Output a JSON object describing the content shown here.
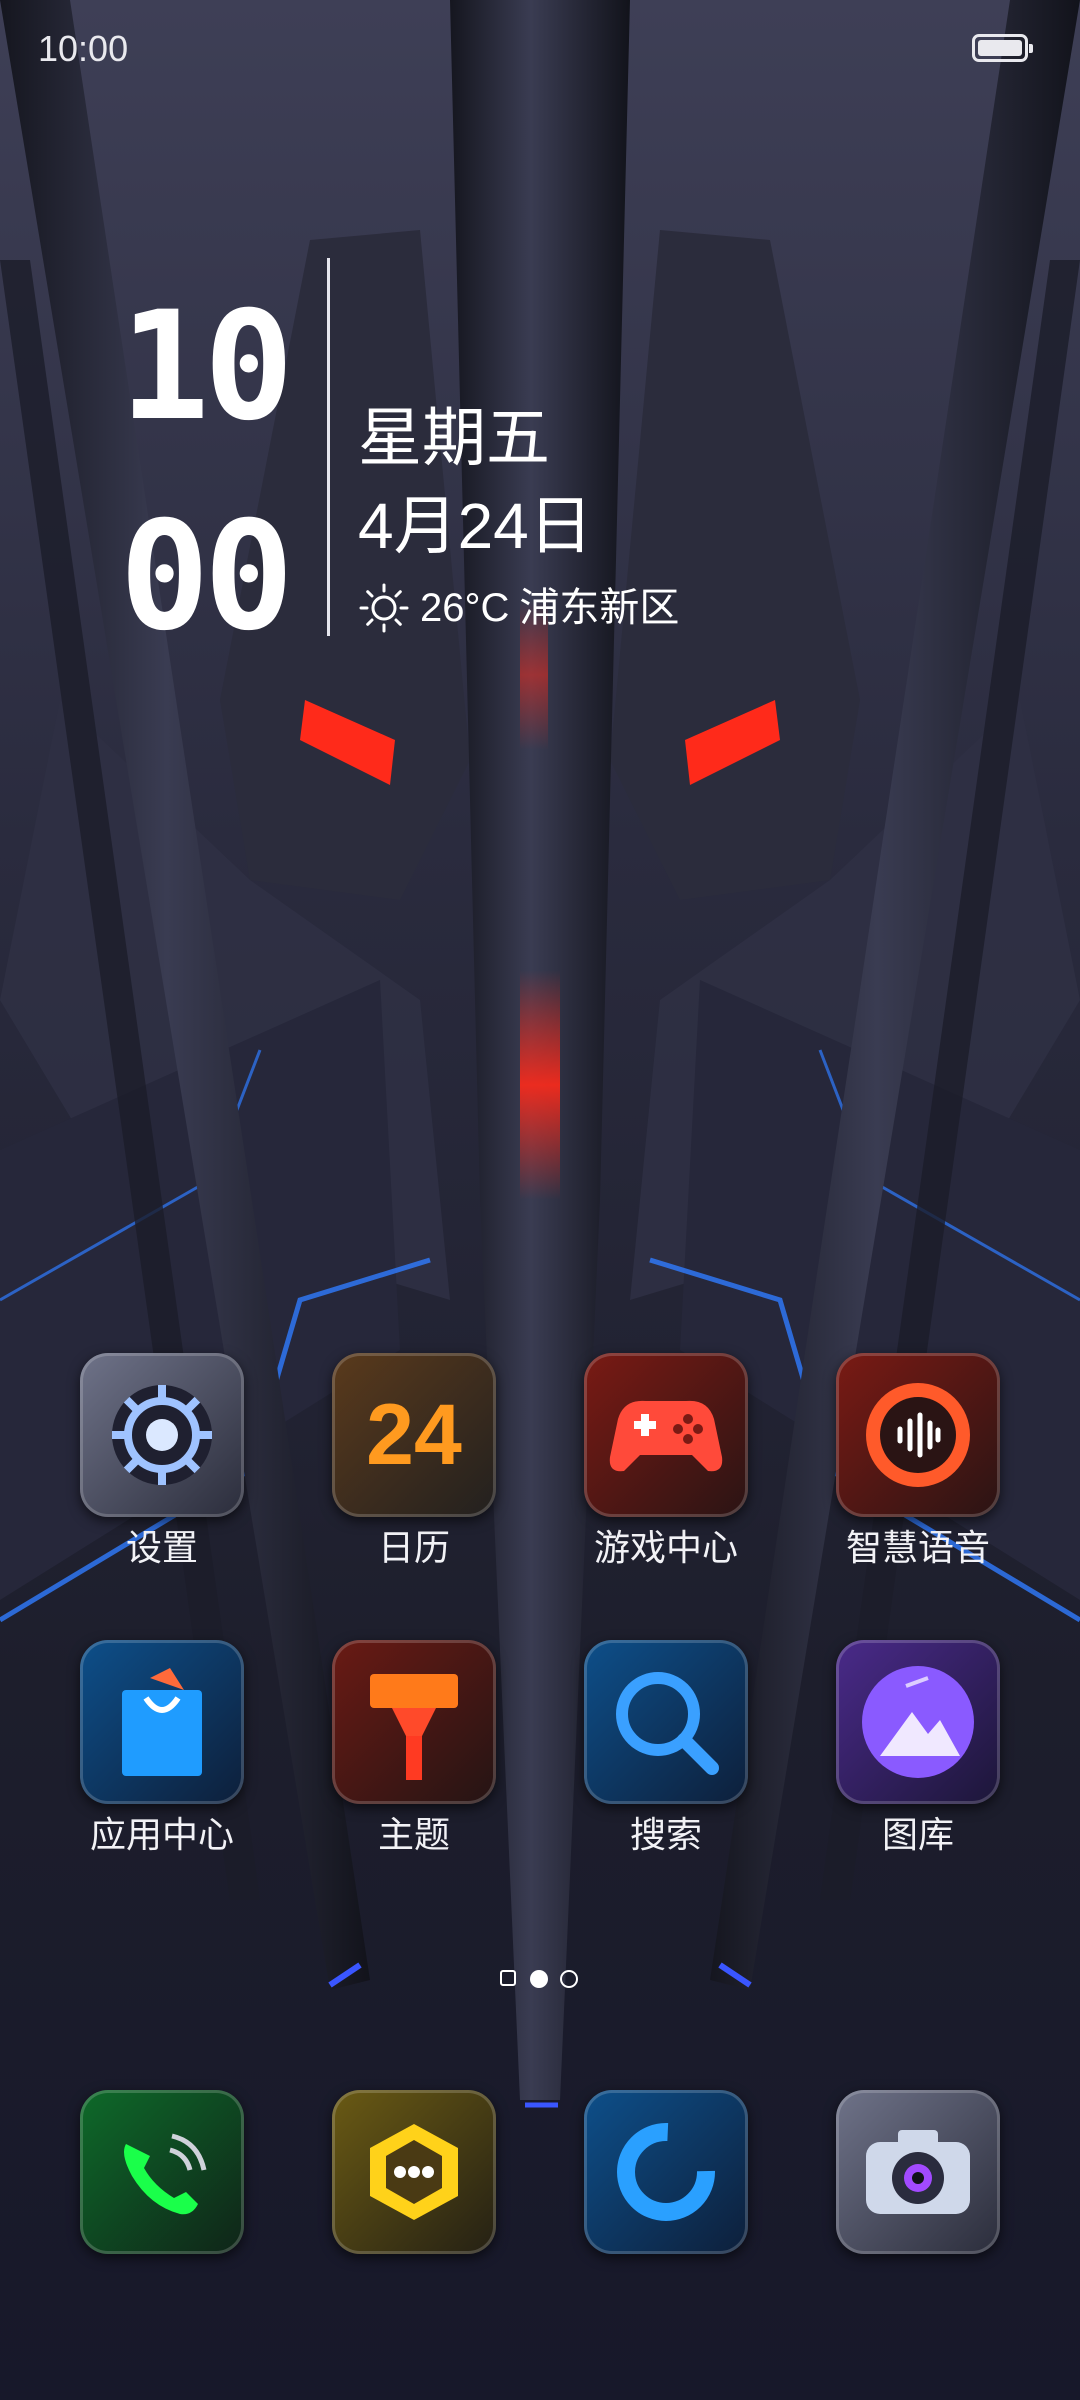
{
  "status_bar": {
    "time": "10:00",
    "battery": "full"
  },
  "widget": {
    "hours": "10",
    "minutes": "00",
    "weekday": "星期五",
    "date": "4月24日",
    "weather_icon": "sun-icon",
    "temperature": "26°C",
    "location": "浦东新区"
  },
  "apps": [
    {
      "label": "设置",
      "icon": "gear-icon"
    },
    {
      "label": "日历",
      "icon": "calendar-icon",
      "badge_text": "24"
    },
    {
      "label": "游戏中心",
      "icon": "gamepad-icon"
    },
    {
      "label": "智慧语音",
      "icon": "voice-assistant-icon"
    },
    {
      "label": "应用中心",
      "icon": "shopping-bag-icon"
    },
    {
      "label": "主题",
      "icon": "theme-brush-icon"
    },
    {
      "label": "搜索",
      "icon": "search-icon"
    },
    {
      "label": "图库",
      "icon": "gallery-icon"
    }
  ],
  "page_indicator": {
    "count": 3,
    "active": 1,
    "first_style": "square"
  },
  "dock": [
    {
      "icon": "phone-icon"
    },
    {
      "icon": "messages-icon"
    },
    {
      "icon": "browser-icon"
    },
    {
      "icon": "camera-icon"
    }
  ],
  "colors": {
    "accent_red": "#ff2a1a",
    "accent_blue": "#2f7cff",
    "background": "#1a1b26"
  }
}
